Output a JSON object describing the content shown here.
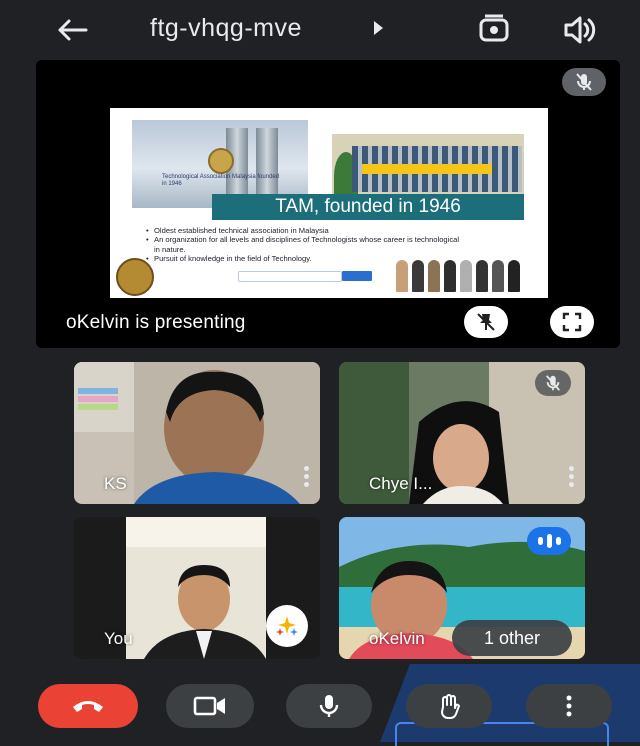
{
  "header": {
    "back_icon": "arrow-left-icon",
    "meeting_code": "ftg-vhqg-mve",
    "caret_icon": "caret-right-icon",
    "switch_camera_icon": "camera-switch-icon",
    "speaker_icon": "speaker-icon"
  },
  "stage": {
    "presenter_text": "oKelvin is presenting",
    "slide": {
      "banner": "TAM, founded in 1946",
      "org_name": "Technological Association Malaysia founded in 1946",
      "bullets": [
        "Oldest established technical association in Malaysia",
        "An organization for all levels and  disciplines of Technologists whose career is technological in nature.",
        "Pursuit of knowledge in the field of Technology."
      ]
    }
  },
  "participants": [
    {
      "name": "KS",
      "muted": false
    },
    {
      "name": "Chye I...",
      "muted": true
    },
    {
      "name": "You",
      "muted": false
    },
    {
      "name": "oKelvin",
      "muted": false,
      "speaking": true
    }
  ],
  "others": {
    "label": "1 other"
  },
  "controls": {
    "end_call_icon": "phone-hangup-icon",
    "camera_icon": "video-camera-icon",
    "mic_icon": "microphone-icon",
    "raise_hand_icon": "raise-hand-icon",
    "more_icon": "more-vert-icon"
  },
  "colors": {
    "background": "#202124",
    "end_call": "#ea4335",
    "control": "#3c4043",
    "speaking": "#1a73e8",
    "banner": "#1c6f7a"
  }
}
